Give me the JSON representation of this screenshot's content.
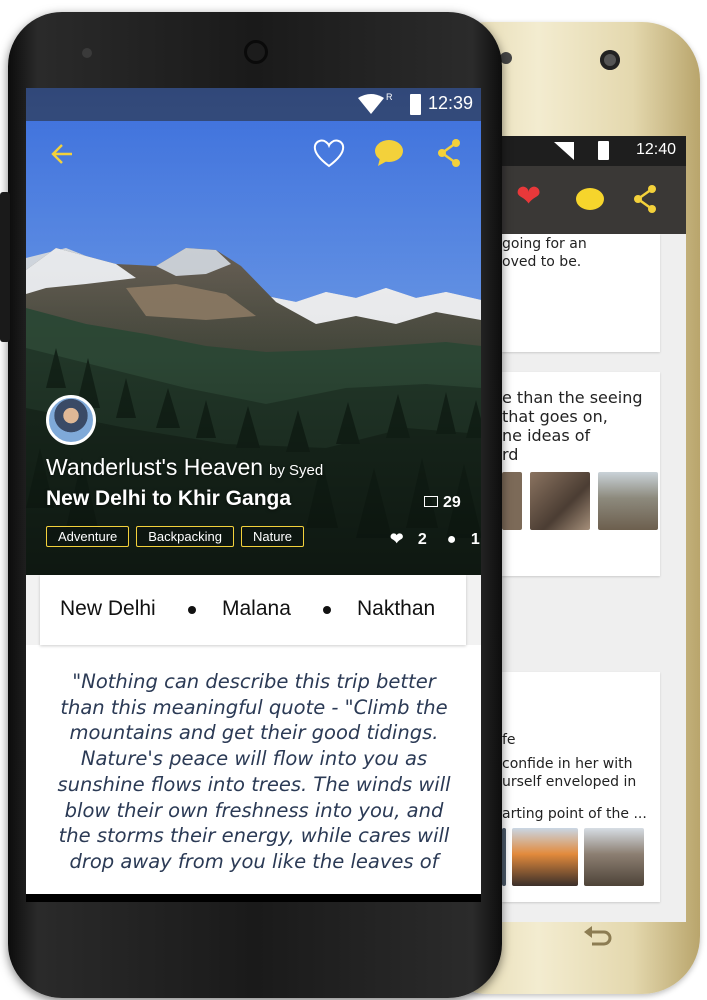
{
  "back_phone": {
    "status": {
      "time": "12:40"
    },
    "texts": {
      "line1": "going for an",
      "line2": "oved to be.",
      "line3": "e than the seeing",
      "line4": "that goes on,",
      "line5": "ne ideas of",
      "line6": "rd",
      "line7": "fe",
      "line8": "confide in her with",
      "line9": "urself enveloped in",
      "line10": "arting point of the ..."
    }
  },
  "status": {
    "time": "12:39"
  },
  "toolbar": {
    "back_icon": "back-arrow-icon",
    "like_icon": "heart-outline-icon",
    "comment_icon": "comment-bubble-icon",
    "share_icon": "share-icon",
    "accent": "#f3d13b"
  },
  "trip": {
    "title": "Wanderlust's Heaven",
    "by": "by Syed",
    "route": "New Delhi to Khir Ganga",
    "photo_count": "29",
    "likes": "2",
    "comments": "1",
    "tags": [
      "Adventure",
      "Backpacking",
      "Nature"
    ]
  },
  "stops": [
    "New Delhi",
    "Malana",
    "Nakthan"
  ],
  "quote": "\"Nothing can describe this trip better than this meaningful quote - \"Climb the mountains and get their good tidings. Nature's peace will flow into you as sunshine flows into trees. The winds will blow their own freshness into you, and the storms their energy, while cares will drop away from you like the leaves of"
}
